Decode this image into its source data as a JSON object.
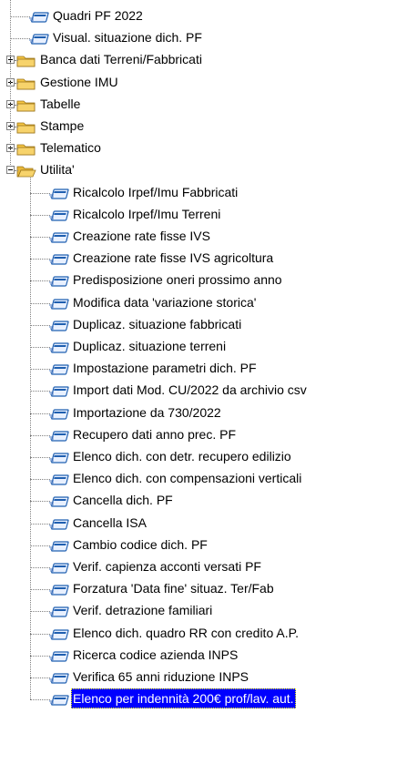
{
  "tree": {
    "top_items": [
      {
        "label": "Quadri PF 2022",
        "type": "form"
      },
      {
        "label": "Visual. situazione dich. PF",
        "type": "form"
      }
    ],
    "folders": [
      {
        "label": "Banca dati Terreni/Fabbricati",
        "expanded": false
      },
      {
        "label": "Gestione IMU",
        "expanded": false
      },
      {
        "label": "Tabelle",
        "expanded": false
      },
      {
        "label": "Stampe",
        "expanded": false
      },
      {
        "label": "Telematico",
        "expanded": false
      },
      {
        "label": "Utilita'",
        "expanded": true
      }
    ],
    "utilita_children": [
      {
        "label": "Ricalcolo Irpef/Imu Fabbricati"
      },
      {
        "label": "Ricalcolo Irpef/Imu Terreni"
      },
      {
        "label": "Creazione rate fisse IVS"
      },
      {
        "label": "Creazione rate fisse IVS agricoltura"
      },
      {
        "label": "Predisposizione oneri prossimo anno"
      },
      {
        "label": "Modifica data 'variazione storica'"
      },
      {
        "label": "Duplicaz. situazione fabbricati"
      },
      {
        "label": "Duplicaz. situazione terreni"
      },
      {
        "label": "Impostazione parametri dich. PF"
      },
      {
        "label": "Import dati Mod. CU/2022 da archivio csv"
      },
      {
        "label": "Importazione da 730/2022"
      },
      {
        "label": "Recupero dati anno prec. PF"
      },
      {
        "label": "Elenco dich. con detr. recupero edilizio"
      },
      {
        "label": "Elenco dich. con compensazioni verticali"
      },
      {
        "label": "Cancella dich. PF"
      },
      {
        "label": "Cancella ISA"
      },
      {
        "label": "Cambio codice dich. PF"
      },
      {
        "label": "Verif. capienza acconti versati PF"
      },
      {
        "label": "Forzatura 'Data fine' situaz. Ter/Fab"
      },
      {
        "label": "Verif. detrazione familiari"
      },
      {
        "label": "Elenco dich. quadro RR con credito A.P."
      },
      {
        "label": "Ricerca codice azienda INPS"
      },
      {
        "label": "Verifica 65 anni riduzione INPS"
      },
      {
        "label": "Elenco per indennità 200€ prof/lav. aut.",
        "selected": true
      }
    ],
    "colors": {
      "selection_bg": "#0000ff",
      "selection_text": "#ffffff",
      "folder_yellow": "#f5c542",
      "form_blue": "#1f5fb0"
    }
  }
}
